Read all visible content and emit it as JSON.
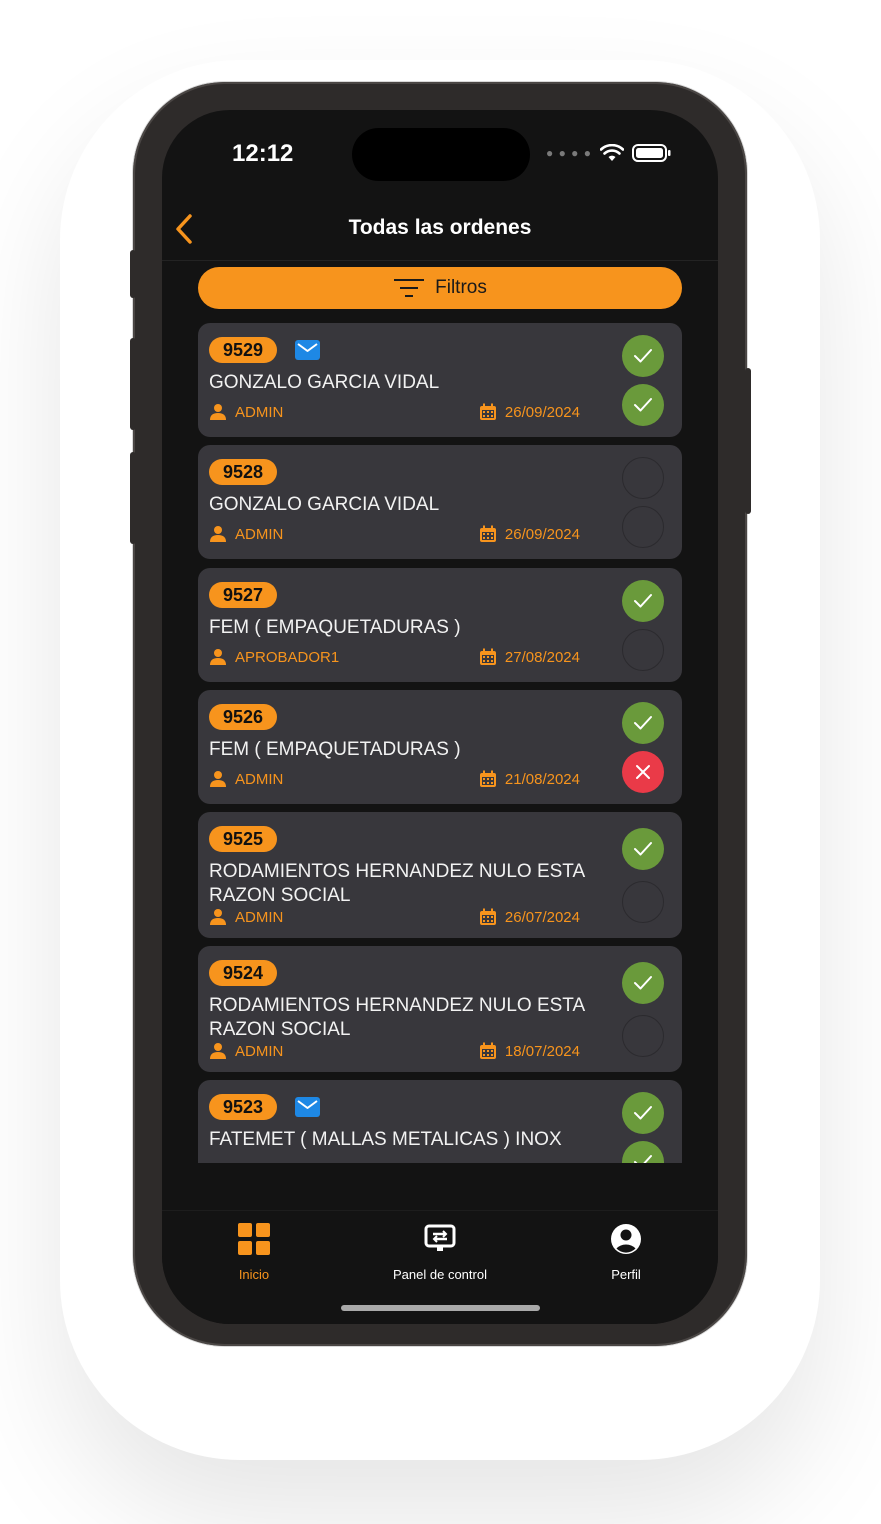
{
  "status_bar": {
    "time": "12:12"
  },
  "nav": {
    "title": "Todas las ordenes",
    "back_icon": "chevron-left-icon"
  },
  "filter": {
    "label": "Filtros",
    "icon": "filter-icon"
  },
  "colors": {
    "accent": "#f7941d",
    "approved": "#6a9a3b",
    "rejected": "#ea3a48",
    "card": "#38373c"
  },
  "orders": [
    {
      "number": "9529",
      "mail": true,
      "client": "GONZALO GARCIA VIDAL",
      "user": "ADMIN",
      "date": "26/09/2024",
      "status1": "ok",
      "status2": "ok"
    },
    {
      "number": "9528",
      "mail": false,
      "client": "GONZALO GARCIA VIDAL",
      "user": "ADMIN",
      "date": "26/09/2024",
      "status1": "empty",
      "status2": "empty"
    },
    {
      "number": "9527",
      "mail": false,
      "client": "FEM  ( EMPAQUETADURAS )",
      "user": "APROBADOR1",
      "date": "27/08/2024",
      "status1": "ok",
      "status2": "empty"
    },
    {
      "number": "9526",
      "mail": false,
      "client": "FEM  ( EMPAQUETADURAS )",
      "user": "ADMIN",
      "date": "21/08/2024",
      "status1": "ok",
      "status2": "no"
    },
    {
      "number": "9525",
      "mail": false,
      "client": "RODAMIENTOS HERNANDEZ NULO ESTA RAZON SOCIAL",
      "user": "ADMIN",
      "date": "26/07/2024",
      "status1": "ok",
      "status2": "empty"
    },
    {
      "number": "9524",
      "mail": false,
      "client": "RODAMIENTOS HERNANDEZ NULO ESTA RAZON SOCIAL",
      "user": "ADMIN",
      "date": "18/07/2024",
      "status1": "ok",
      "status2": "empty"
    },
    {
      "number": "9523",
      "mail": true,
      "client": "FATEMET ( MALLAS METALICAS ) INOX",
      "user": "",
      "date": "",
      "status1": "ok",
      "status2": "ok"
    }
  ],
  "tabs": [
    {
      "label": "Inicio",
      "icon": "grid-icon",
      "active": true
    },
    {
      "label": "Panel de control",
      "icon": "monitor-icon",
      "active": false
    },
    {
      "label": "Perfil",
      "icon": "profile-icon",
      "active": false
    }
  ]
}
